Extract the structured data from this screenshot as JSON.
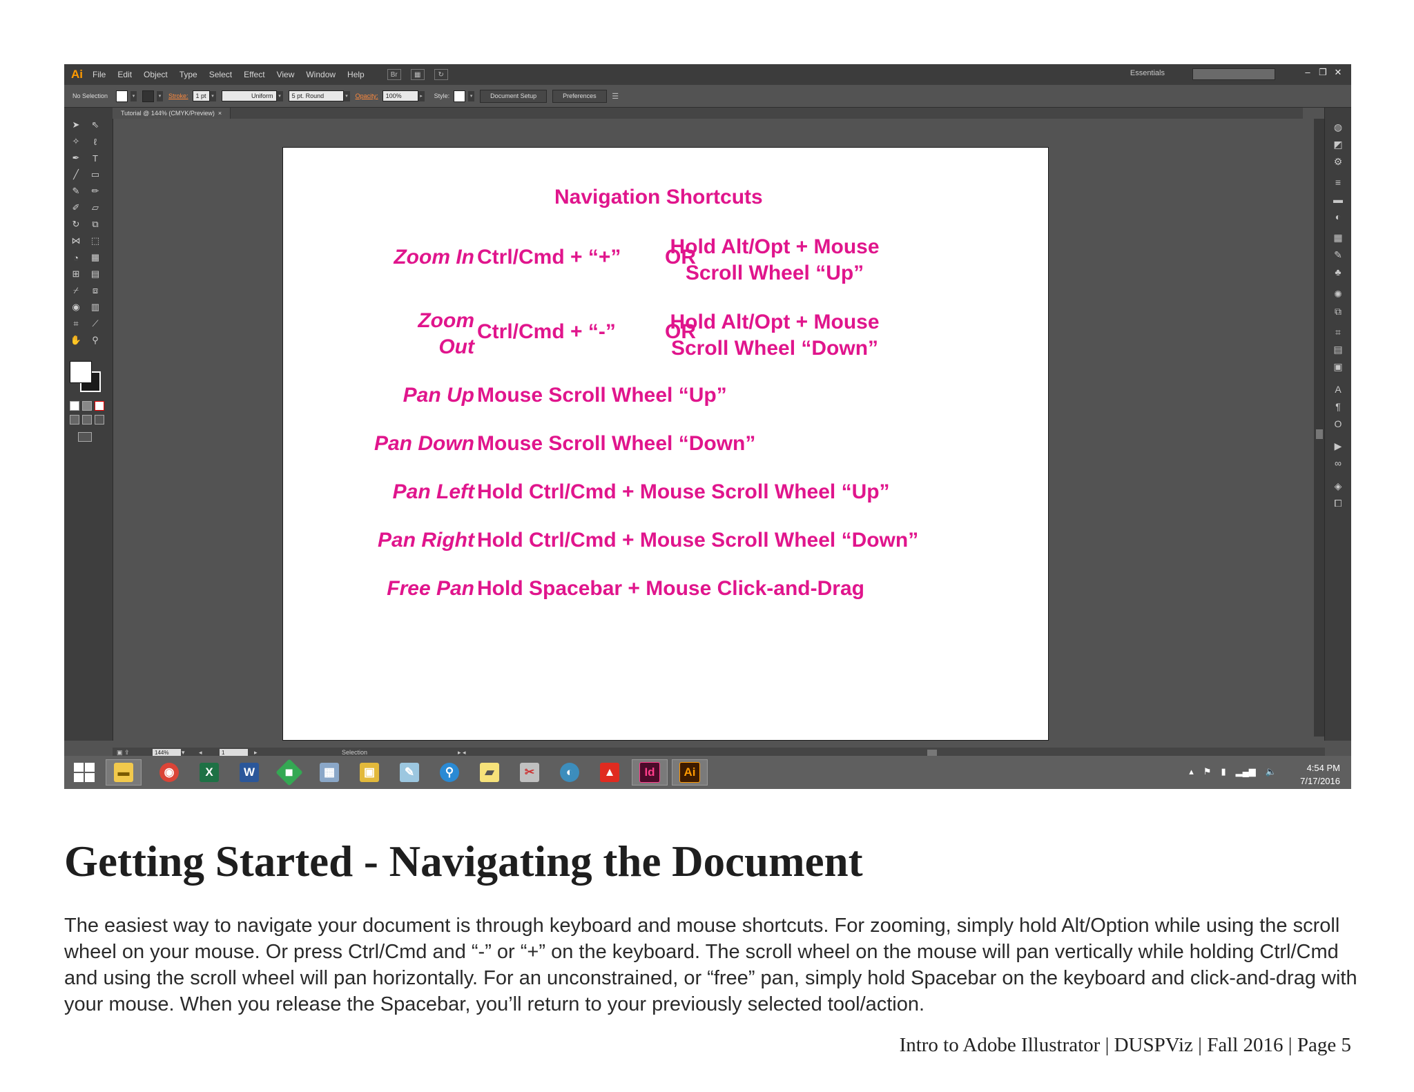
{
  "illustrator": {
    "logo": "Ai",
    "menu": [
      "File",
      "Edit",
      "Object",
      "Type",
      "Select",
      "Effect",
      "View",
      "Window",
      "Help"
    ],
    "workspace": "Essentials",
    "control": {
      "selection": "No Selection",
      "stroke_label": "Stroke:",
      "stroke_value": "1 pt",
      "profile": "Uniform",
      "brush": "5 pt. Round",
      "opacity_label": "Opacity:",
      "opacity_value": "100%",
      "style_label": "Style:",
      "doc_setup": "Document Setup",
      "preferences": "Preferences"
    },
    "doc_tab": "Tutorial @ 144% (CMYK/Preview)",
    "status": {
      "zoom": "144%",
      "artboard": "1",
      "tool": "Selection"
    },
    "clock": {
      "time": "4:54 PM",
      "date": "7/17/2016"
    },
    "taskbar_apps": [
      "File Explorer",
      "Chrome",
      "Excel",
      "Word",
      "Maps",
      "Calculator",
      "Archive",
      "Notes",
      "Search",
      "Sticky Notes",
      "Paint",
      "Network",
      "Acrobat",
      "InDesign",
      "Illustrator"
    ]
  },
  "artboard": {
    "title": "Navigation Shortcuts",
    "rows": [
      {
        "label": "Zoom In",
        "key": "Ctrl/Cmd + “+”",
        "or": "OR",
        "alt1": "Hold Alt/Opt + Mouse",
        "alt2": "Scroll Wheel “Up”"
      },
      {
        "label1": "Zoom",
        "label2": "Out",
        "key": "Ctrl/Cmd + “-”",
        "or": "OR",
        "alt1": "Hold Alt/Opt + Mouse",
        "alt2": "Scroll Wheel “Down”"
      },
      {
        "label": "Pan Up",
        "key": "Mouse Scroll Wheel “Up”"
      },
      {
        "label": "Pan Down",
        "key": "Mouse Scroll Wheel “Down”"
      },
      {
        "label": "Pan Left",
        "key": "Hold Ctrl/Cmd + Mouse Scroll Wheel “Up”"
      },
      {
        "label": "Pan Right",
        "key": "Hold Ctrl/Cmd + Mouse Scroll Wheel “Down”"
      },
      {
        "label": "Free Pan",
        "key": "Hold Spacebar + Mouse Click-and-Drag"
      }
    ]
  },
  "page": {
    "heading": "Getting Started - Navigating the Document",
    "body": "The easiest way to navigate your document is through keyboard and mouse shortcuts. For zooming, simply hold Alt/Option while using the scroll wheel on your mouse. Or press Ctrl/Cmd and “-” or “+” on the keyboard. The scroll wheel on the mouse will pan vertically while holding Ctrl/Cmd and using the scroll wheel will pan horizontally. For an unconstrained, or “free” pan, simply hold Spacebar on the keyboard and click-and-drag with your mouse. When you release the Spacebar, you’ll return to your previously selected tool/action.",
    "footer": "Intro to Adobe Illustrator | DUSPViz | Fall 2016 | Page 5"
  }
}
